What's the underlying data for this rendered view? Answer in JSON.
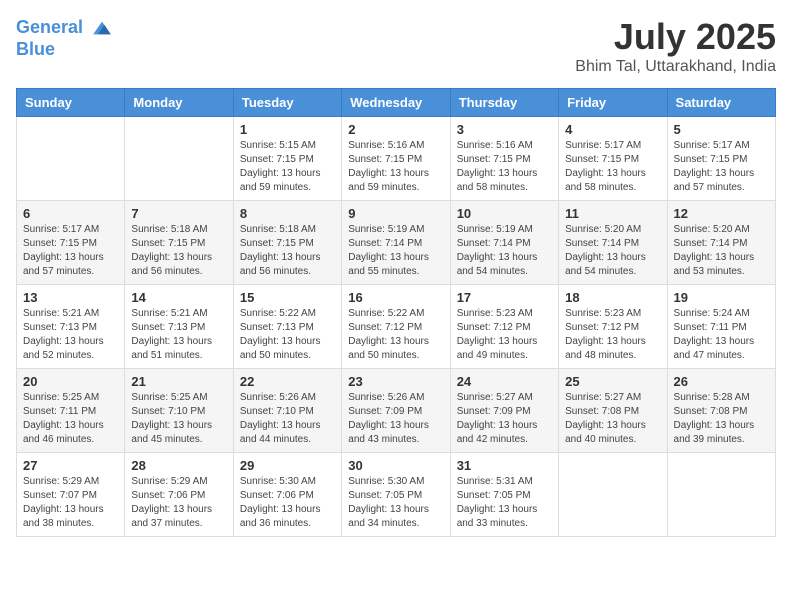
{
  "header": {
    "logo_line1": "General",
    "logo_line2": "Blue",
    "month": "July 2025",
    "location": "Bhim Tal, Uttarakhand, India"
  },
  "weekdays": [
    "Sunday",
    "Monday",
    "Tuesday",
    "Wednesday",
    "Thursday",
    "Friday",
    "Saturday"
  ],
  "weeks": [
    [
      {
        "day": "",
        "info": ""
      },
      {
        "day": "",
        "info": ""
      },
      {
        "day": "1",
        "info": "Sunrise: 5:15 AM\nSunset: 7:15 PM\nDaylight: 13 hours and 59 minutes."
      },
      {
        "day": "2",
        "info": "Sunrise: 5:16 AM\nSunset: 7:15 PM\nDaylight: 13 hours and 59 minutes."
      },
      {
        "day": "3",
        "info": "Sunrise: 5:16 AM\nSunset: 7:15 PM\nDaylight: 13 hours and 58 minutes."
      },
      {
        "day": "4",
        "info": "Sunrise: 5:17 AM\nSunset: 7:15 PM\nDaylight: 13 hours and 58 minutes."
      },
      {
        "day": "5",
        "info": "Sunrise: 5:17 AM\nSunset: 7:15 PM\nDaylight: 13 hours and 57 minutes."
      }
    ],
    [
      {
        "day": "6",
        "info": "Sunrise: 5:17 AM\nSunset: 7:15 PM\nDaylight: 13 hours and 57 minutes."
      },
      {
        "day": "7",
        "info": "Sunrise: 5:18 AM\nSunset: 7:15 PM\nDaylight: 13 hours and 56 minutes."
      },
      {
        "day": "8",
        "info": "Sunrise: 5:18 AM\nSunset: 7:15 PM\nDaylight: 13 hours and 56 minutes."
      },
      {
        "day": "9",
        "info": "Sunrise: 5:19 AM\nSunset: 7:14 PM\nDaylight: 13 hours and 55 minutes."
      },
      {
        "day": "10",
        "info": "Sunrise: 5:19 AM\nSunset: 7:14 PM\nDaylight: 13 hours and 54 minutes."
      },
      {
        "day": "11",
        "info": "Sunrise: 5:20 AM\nSunset: 7:14 PM\nDaylight: 13 hours and 54 minutes."
      },
      {
        "day": "12",
        "info": "Sunrise: 5:20 AM\nSunset: 7:14 PM\nDaylight: 13 hours and 53 minutes."
      }
    ],
    [
      {
        "day": "13",
        "info": "Sunrise: 5:21 AM\nSunset: 7:13 PM\nDaylight: 13 hours and 52 minutes."
      },
      {
        "day": "14",
        "info": "Sunrise: 5:21 AM\nSunset: 7:13 PM\nDaylight: 13 hours and 51 minutes."
      },
      {
        "day": "15",
        "info": "Sunrise: 5:22 AM\nSunset: 7:13 PM\nDaylight: 13 hours and 50 minutes."
      },
      {
        "day": "16",
        "info": "Sunrise: 5:22 AM\nSunset: 7:12 PM\nDaylight: 13 hours and 50 minutes."
      },
      {
        "day": "17",
        "info": "Sunrise: 5:23 AM\nSunset: 7:12 PM\nDaylight: 13 hours and 49 minutes."
      },
      {
        "day": "18",
        "info": "Sunrise: 5:23 AM\nSunset: 7:12 PM\nDaylight: 13 hours and 48 minutes."
      },
      {
        "day": "19",
        "info": "Sunrise: 5:24 AM\nSunset: 7:11 PM\nDaylight: 13 hours and 47 minutes."
      }
    ],
    [
      {
        "day": "20",
        "info": "Sunrise: 5:25 AM\nSunset: 7:11 PM\nDaylight: 13 hours and 46 minutes."
      },
      {
        "day": "21",
        "info": "Sunrise: 5:25 AM\nSunset: 7:10 PM\nDaylight: 13 hours and 45 minutes."
      },
      {
        "day": "22",
        "info": "Sunrise: 5:26 AM\nSunset: 7:10 PM\nDaylight: 13 hours and 44 minutes."
      },
      {
        "day": "23",
        "info": "Sunrise: 5:26 AM\nSunset: 7:09 PM\nDaylight: 13 hours and 43 minutes."
      },
      {
        "day": "24",
        "info": "Sunrise: 5:27 AM\nSunset: 7:09 PM\nDaylight: 13 hours and 42 minutes."
      },
      {
        "day": "25",
        "info": "Sunrise: 5:27 AM\nSunset: 7:08 PM\nDaylight: 13 hours and 40 minutes."
      },
      {
        "day": "26",
        "info": "Sunrise: 5:28 AM\nSunset: 7:08 PM\nDaylight: 13 hours and 39 minutes."
      }
    ],
    [
      {
        "day": "27",
        "info": "Sunrise: 5:29 AM\nSunset: 7:07 PM\nDaylight: 13 hours and 38 minutes."
      },
      {
        "day": "28",
        "info": "Sunrise: 5:29 AM\nSunset: 7:06 PM\nDaylight: 13 hours and 37 minutes."
      },
      {
        "day": "29",
        "info": "Sunrise: 5:30 AM\nSunset: 7:06 PM\nDaylight: 13 hours and 36 minutes."
      },
      {
        "day": "30",
        "info": "Sunrise: 5:30 AM\nSunset: 7:05 PM\nDaylight: 13 hours and 34 minutes."
      },
      {
        "day": "31",
        "info": "Sunrise: 5:31 AM\nSunset: 7:05 PM\nDaylight: 13 hours and 33 minutes."
      },
      {
        "day": "",
        "info": ""
      },
      {
        "day": "",
        "info": ""
      }
    ]
  ]
}
